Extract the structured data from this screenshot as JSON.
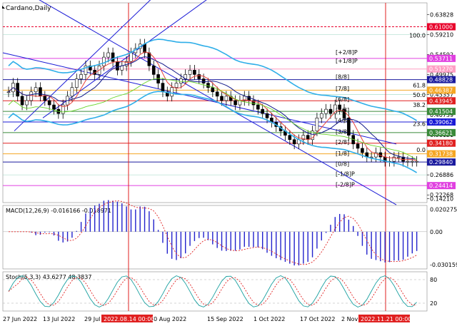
{
  "title": "Cardano,Daily",
  "colors": {
    "red_line": "#e8413a",
    "blue_line": "#1a1ad6",
    "green_line": "#2e8b2e",
    "dark_line": "#121a8a",
    "magenta": "#e040e0",
    "cyan": "#29a9e0",
    "lime": "#6ad62c",
    "orange": "#f0a418",
    "pink": "#ff8bb0",
    "bb": "#2eaee8",
    "candle_bear": "#000000",
    "candle_bull": "#000000",
    "macd_hist": "#2222cc",
    "signal": "#e02020"
  },
  "chart_data": [
    {
      "type": "line",
      "name": "price",
      "title": "Cardano,Daily",
      "y_ticks": [
        "0.63828",
        "0.59210",
        "0.54592",
        "0.49975",
        "0.45357",
        "0.40739",
        "0.36121",
        "0.31504",
        "0.26886",
        "0.22268",
        "0.14210"
      ],
      "y_tick_values": [
        0.63828,
        0.5921,
        0.54592,
        0.49975,
        0.45357,
        0.40739,
        0.36121,
        0.31504,
        0.26886,
        0.22268,
        0.2141
      ],
      "ylim": [
        0.205,
        0.665
      ],
      "price_levels": [
        {
          "label": "0.61000",
          "value": 0.61,
          "color": "#e8002a"
        },
        {
          "label": "0.53711",
          "value": 0.53711,
          "color": "#e040e0"
        },
        {
          "label": "0.51270",
          "value": 0.5127,
          "color": "#ff9ec4"
        },
        {
          "label": "0.48828",
          "value": 0.48828,
          "color": "#1a1a9e"
        },
        {
          "label": "0.46387",
          "value": 0.46387,
          "color": "#f5a623"
        },
        {
          "label": "0.43945",
          "value": 0.43945,
          "color": "#e02020"
        },
        {
          "label": "0.41504",
          "value": 0.41504,
          "color": "#3a8a3a"
        },
        {
          "label": "0.39062",
          "value": 0.39062,
          "color": "#1a1ad6"
        },
        {
          "label": "0.36621",
          "value": 0.36621,
          "color": "#3a8a3a"
        },
        {
          "label": "0.34180",
          "value": 0.3418,
          "color": "#e02020"
        },
        {
          "label": "0.31738",
          "value": 0.31738,
          "color": "#f5a623"
        },
        {
          "label": "0.29840",
          "value": 0.2984,
          "color": "#1a1a9e"
        },
        {
          "label": "0.24414",
          "value": 0.24414,
          "color": "#e040e0"
        }
      ],
      "murrey_labels": [
        "[+2/8]P",
        "[+1/8]P",
        "[8/8]",
        "[7/8]",
        "[6/8]",
        "[5/8]",
        "[4/8]",
        "[3/8]",
        "[2/8]",
        "[1/8]",
        "[0/8]",
        "[-1/8]P",
        "[-2/8]P"
      ],
      "fib_labels": [
        "100.0",
        "61.8",
        "50.0",
        "38.2",
        "23.6",
        "0.0"
      ],
      "closes": [
        0.46,
        0.48,
        0.45,
        0.43,
        0.44,
        0.46,
        0.47,
        0.45,
        0.44,
        0.43,
        0.42,
        0.41,
        0.43,
        0.45,
        0.47,
        0.49,
        0.5,
        0.52,
        0.51,
        0.5,
        0.52,
        0.54,
        0.55,
        0.53,
        0.51,
        0.52,
        0.53,
        0.55,
        0.56,
        0.57,
        0.55,
        0.52,
        0.5,
        0.48,
        0.46,
        0.45,
        0.47,
        0.48,
        0.49,
        0.5,
        0.51,
        0.5,
        0.49,
        0.48,
        0.47,
        0.46,
        0.45,
        0.44,
        0.45,
        0.44,
        0.43,
        0.44,
        0.45,
        0.44,
        0.43,
        0.42,
        0.41,
        0.4,
        0.39,
        0.38,
        0.37,
        0.36,
        0.35,
        0.34,
        0.35,
        0.36,
        0.35,
        0.37,
        0.4,
        0.41,
        0.42,
        0.41,
        0.43,
        0.42,
        0.4,
        0.36,
        0.34,
        0.33,
        0.32,
        0.31,
        0.31,
        0.32,
        0.31,
        0.3,
        0.3,
        0.31,
        0.31,
        0.3,
        0.3,
        0.3,
        0.3
      ]
    },
    {
      "type": "bar",
      "name": "macd",
      "title": "MACD(12,26,9) -0.016166 -0.018971",
      "y_ticks": [
        "0.020275",
        "0.00",
        "-0.030159"
      ],
      "y_tick_values": [
        0.020275,
        0.0,
        -0.030159
      ],
      "ylim": [
        -0.034,
        0.024
      ]
    },
    {
      "type": "line",
      "name": "stoch",
      "title": "Stoch(5,3,3) 43.6277 48.3837",
      "y_ticks": [
        "80",
        "20"
      ],
      "y_tick_values": [
        80,
        20
      ],
      "ylim": [
        0,
        100
      ]
    }
  ],
  "x_labels": [
    "27 Jun 2022",
    "13 Jul 2022",
    "29 Jul",
    "30 Aug 2022",
    "15 Sep 2022",
    "1 Oct 2022",
    "17 Oct 2022",
    "2 Nov 20"
  ],
  "date_tags": [
    "2022.08.14 00:00",
    "2022.11.21 00:00"
  ]
}
